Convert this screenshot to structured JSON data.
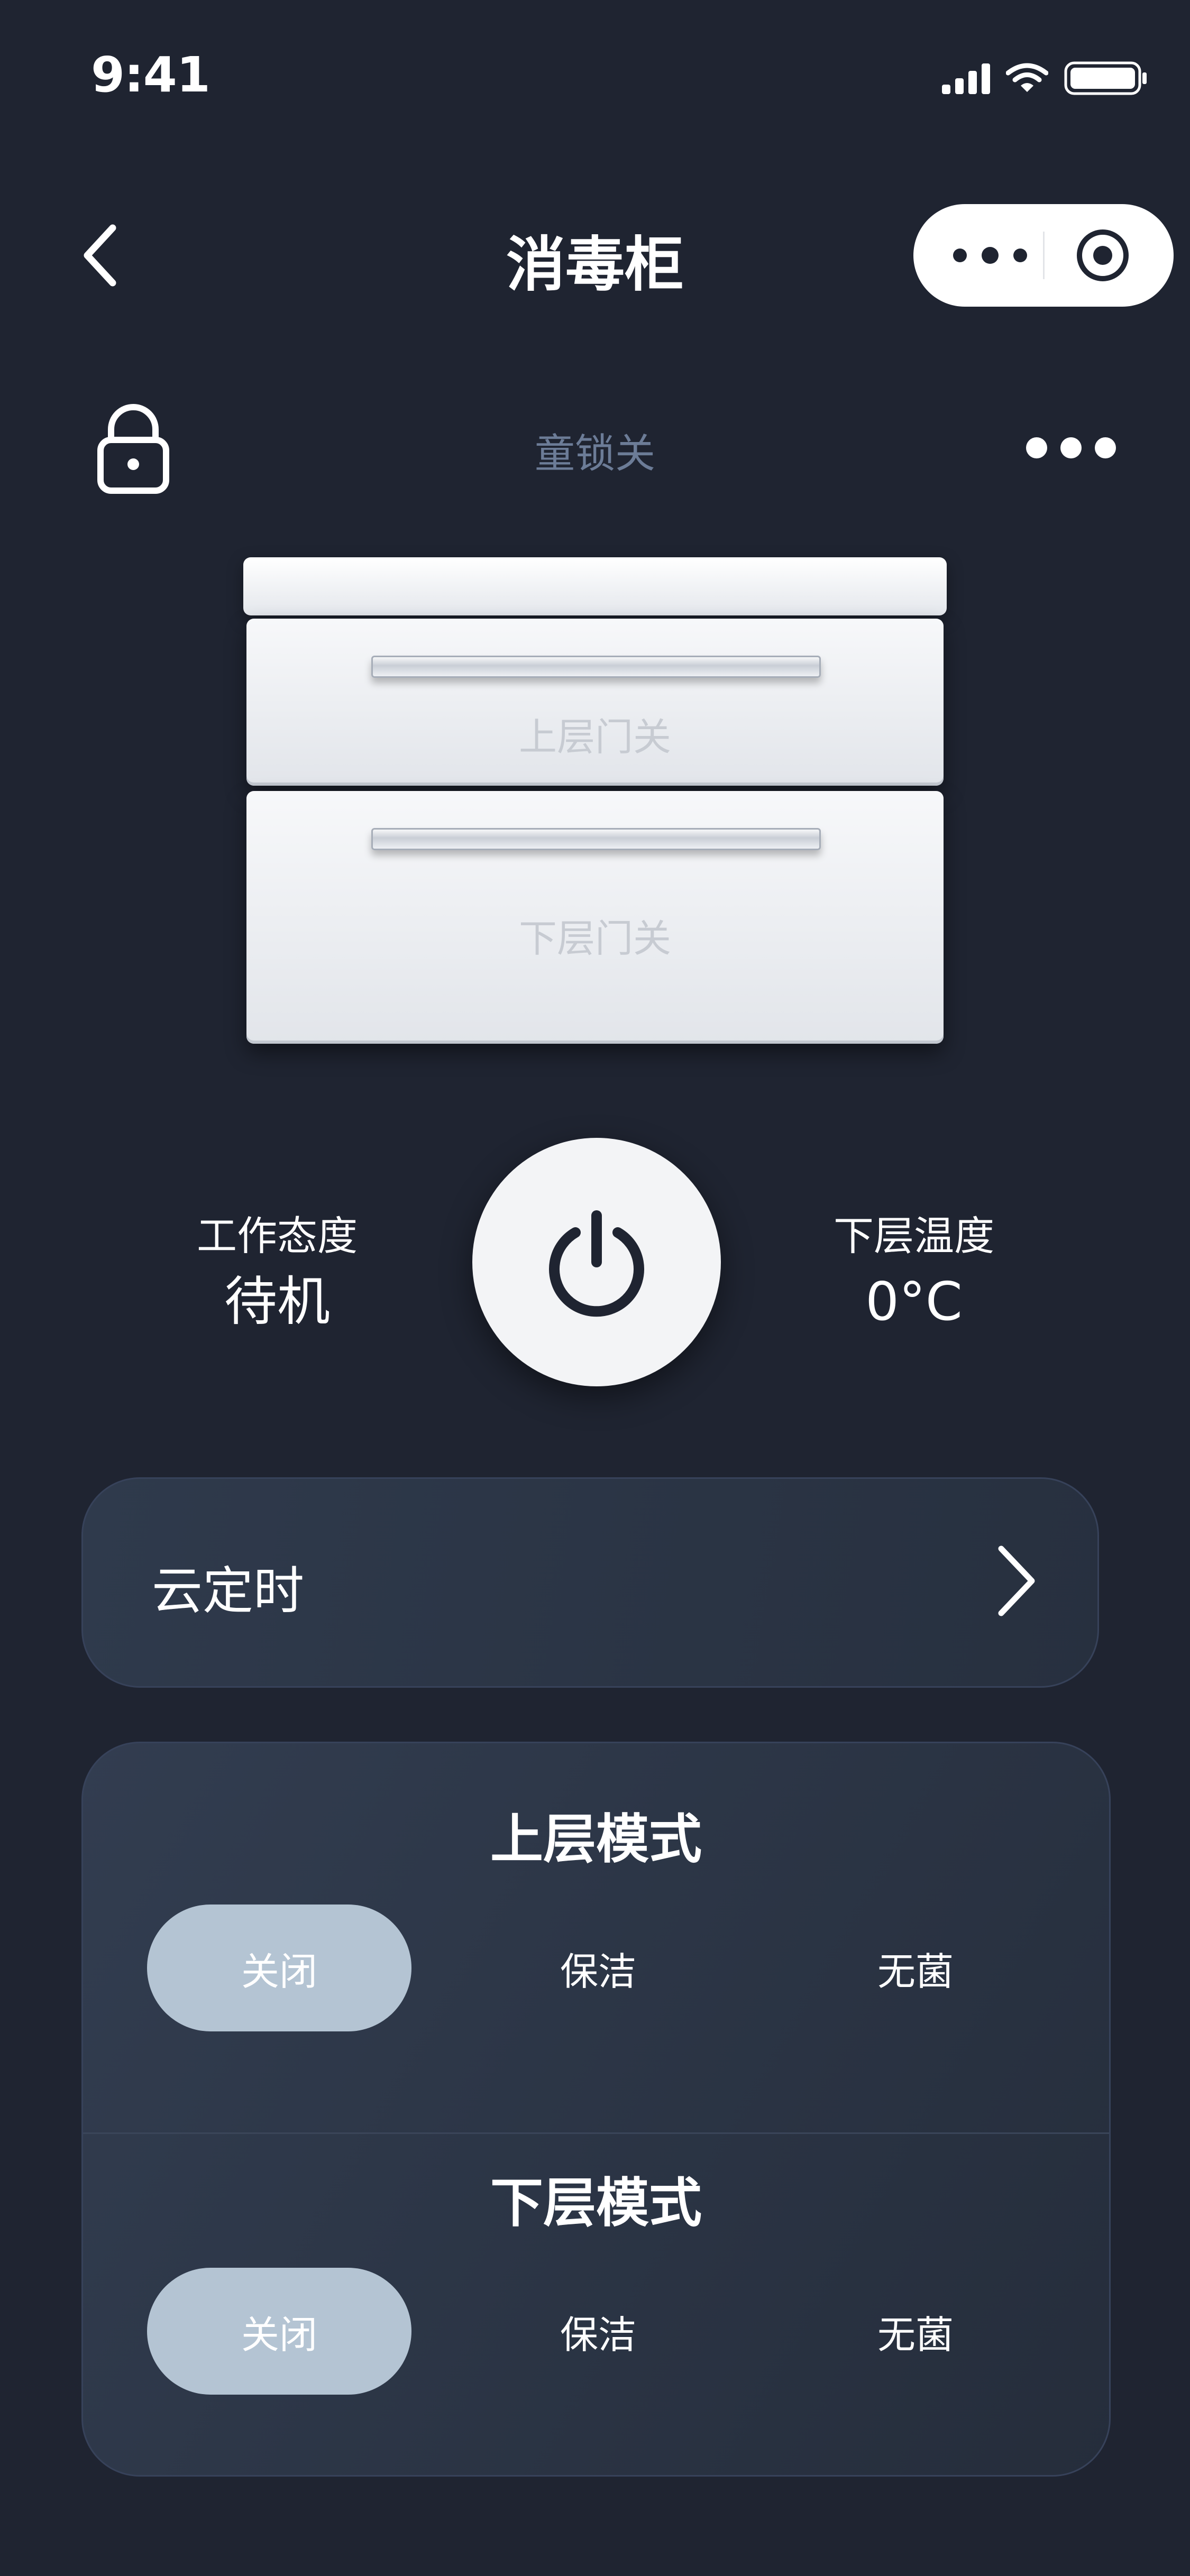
{
  "status_bar": {
    "time": "9:41",
    "icons": [
      "signal-icon",
      "wifi-icon",
      "battery-icon"
    ]
  },
  "nav": {
    "title": "消毒柜",
    "back_icon": "chevron-left-icon",
    "capsule_icons": [
      "more-icon",
      "target-icon"
    ]
  },
  "lock_row": {
    "lock_icon": "lock-icon",
    "status": "童锁关",
    "menu_icon": "more-dots-icon"
  },
  "cabinet": {
    "upper_label": "上层门关",
    "lower_label": "下层门关"
  },
  "status": {
    "work_label": "工作态度",
    "work_value": "待机",
    "temp_label": "下层温度",
    "temp_value": "0°C",
    "power_icon": "power-icon"
  },
  "timer": {
    "label": "云定时",
    "chevron_icon": "chevron-right-icon"
  },
  "modes": {
    "upper": {
      "title": "上层模式",
      "options": [
        "关闭",
        "保洁",
        "无菌"
      ],
      "selected": "关闭"
    },
    "lower": {
      "title": "下层模式",
      "options": [
        "关闭",
        "保洁",
        "无菌"
      ],
      "selected": "关闭"
    }
  },
  "colors": {
    "background": "#1f2431",
    "card": "#2b3444",
    "active_option": "#b4c4d3",
    "muted_text": "#6c7c97"
  }
}
